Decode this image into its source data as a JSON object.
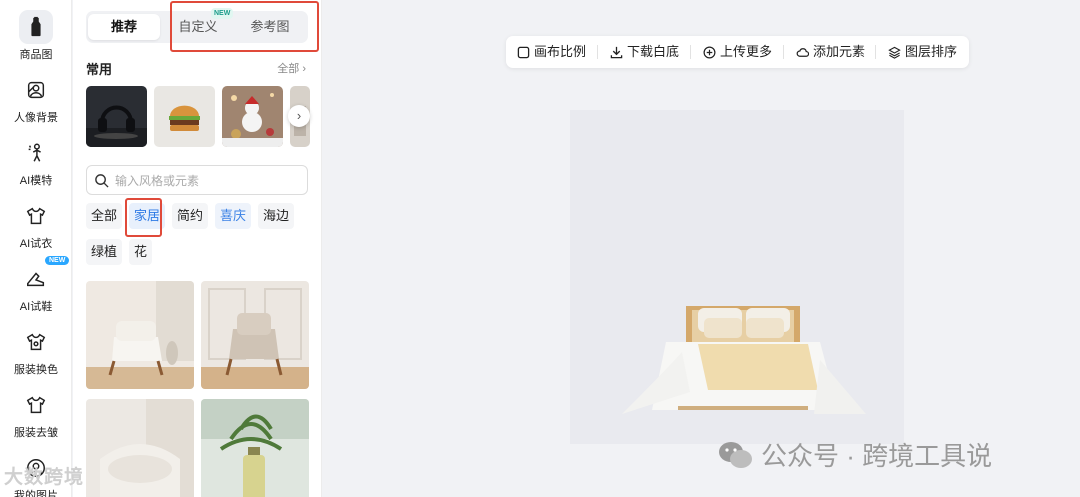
{
  "rail": {
    "items": [
      {
        "label": "商品图",
        "icon": "product-icon",
        "active": true
      },
      {
        "label": "人像背景",
        "icon": "portrait-icon"
      },
      {
        "label": "AI模特",
        "icon": "model-icon"
      },
      {
        "label": "AI试衣",
        "icon": "tryon-icon"
      },
      {
        "label": "AI试鞋",
        "icon": "shoe-icon",
        "badge": "NEW"
      },
      {
        "label": "服装换色",
        "icon": "shirt-color-icon"
      },
      {
        "label": "服装去皱",
        "icon": "shirt-iron-icon"
      },
      {
        "label": "我的图片",
        "icon": "my-images-icon"
      }
    ]
  },
  "panel": {
    "tabs": [
      {
        "label": "推荐",
        "active": true
      },
      {
        "label": "自定义",
        "badge": "NEW"
      },
      {
        "label": "参考图"
      }
    ],
    "common": {
      "title": "常用",
      "more": "全部 ›"
    },
    "search": {
      "placeholder": "输入风格或元素"
    },
    "chips": [
      "全部",
      "家居",
      "简约",
      "喜庆",
      "海边",
      "绿植",
      "花"
    ],
    "selected_chip": "家居"
  },
  "toolbar": {
    "buttons": [
      {
        "label": "画布比例",
        "icon": "checkbox-icon"
      },
      {
        "label": "下载白底",
        "icon": "download-icon"
      },
      {
        "label": "上传更多",
        "icon": "plus-circle-icon"
      },
      {
        "label": "添加元素",
        "icon": "cloud-icon"
      },
      {
        "label": "图层排序",
        "icon": "layers-icon"
      }
    ]
  },
  "watermark": {
    "text": "公众号 · 跨境工具说",
    "left_text": "大数跨境"
  },
  "colors": {
    "accent": "#2f7ae5",
    "highlight_border": "#e04a3a",
    "badge": "#2aa7ff"
  }
}
